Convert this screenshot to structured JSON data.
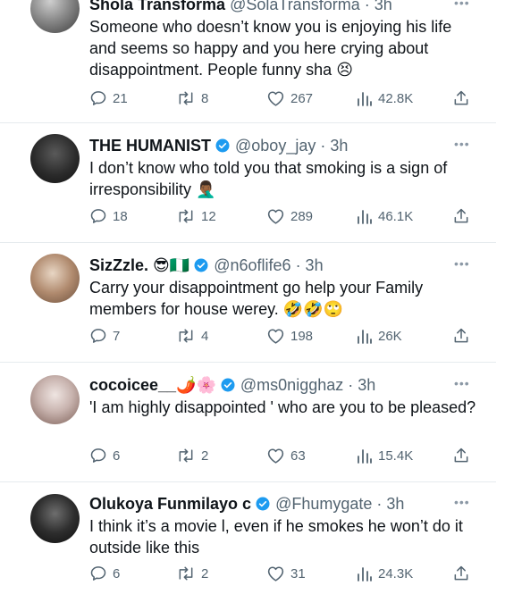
{
  "tweets": [
    {
      "name": "Shola Transforma",
      "handle": "@SolaTransforma",
      "time": "· 3h",
      "text": "Someone who doesn’t know you is enjoying his life and seems so happy and you here crying about disappointment. People funny sha 😣",
      "replies": "21",
      "reposts": "8",
      "likes": "267",
      "views": "42.8K",
      "verified": false
    },
    {
      "name": "THE HUMANIST",
      "handle": "@oboy_jay",
      "time": "· 3h",
      "text": "I don’t know who told you that smoking is a sign of irresponsibility 🤦🏾‍♂️",
      "replies": "18",
      "reposts": "12",
      "likes": "289",
      "views": "46.1K",
      "verified": true
    },
    {
      "name": "SizZzle. 😎🇳🇬",
      "handle": "@n6oflife6",
      "time": "· 3h",
      "text": "Carry your disappointment go help your Family members for house werey. 🤣🤣🙄",
      "replies": "7",
      "reposts": "4",
      "likes": "198",
      "views": "26K",
      "verified": true
    },
    {
      "name": "cocoicee__🌶️🌸",
      "handle": "@ms0nigghaz",
      "time": "· 3h",
      "text": "'I am highly disappointed ' who are you to be pleased?",
      "replies": "6",
      "reposts": "2",
      "likes": "63",
      "views": "15.4K",
      "verified": true
    },
    {
      "name": "Olukoya Funmilayo c",
      "handle": "@Fhumygate",
      "time": "· 3h",
      "text": "I think it’s a movie l, even if he smokes he won’t do it outside like this",
      "replies": "6",
      "reposts": "2",
      "likes": "31",
      "views": "24.3K",
      "verified": true
    }
  ],
  "colors": {
    "verified": "#1d9bf0",
    "muted": "#536471",
    "divider": "#e6ebee"
  },
  "icons": [
    "reply-icon",
    "repost-icon",
    "like-icon",
    "views-icon",
    "share-icon",
    "verified-badge-icon",
    "more-icon"
  ]
}
